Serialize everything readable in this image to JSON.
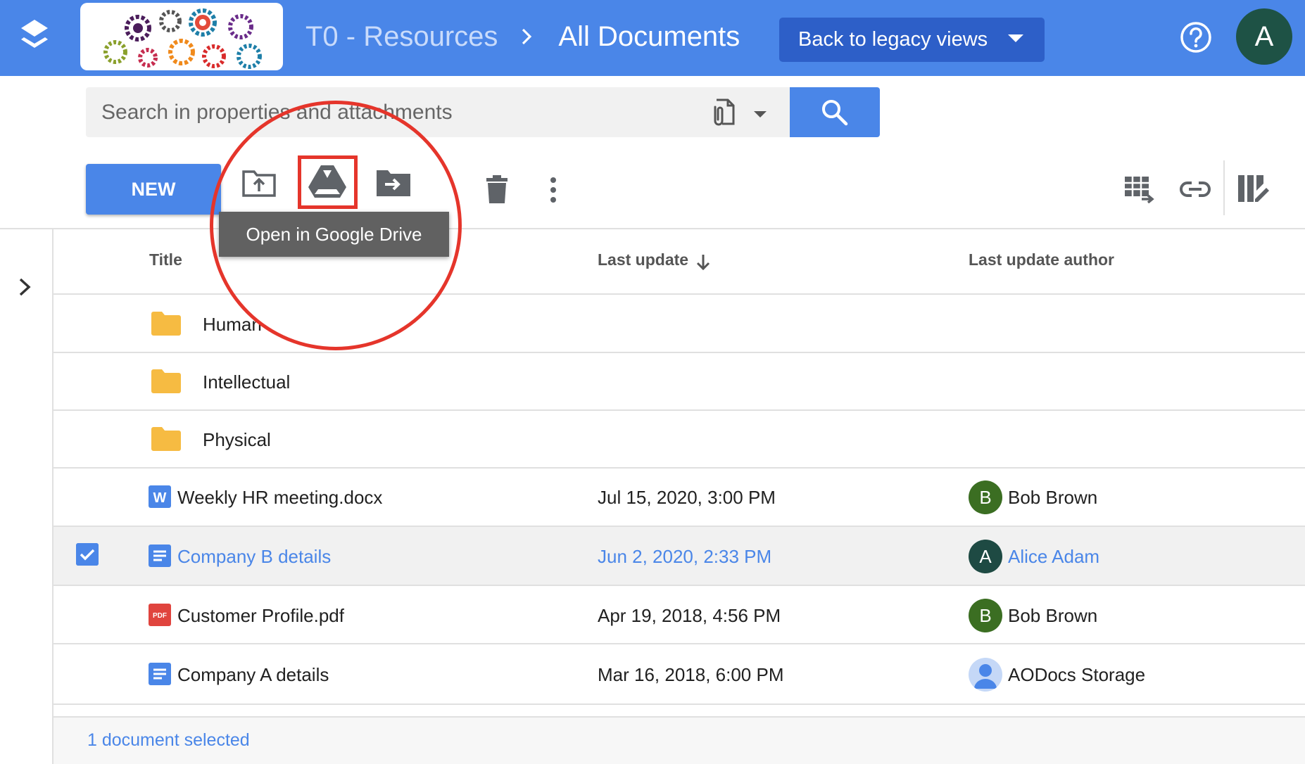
{
  "header": {
    "breadcrumb_parent": "T0 - Resources",
    "breadcrumb_current": "All Documents",
    "legacy_button": "Back to legacy views",
    "avatar_letter": "A",
    "colors": {
      "header": "#4a86e8",
      "legacy_button": "#2d5fc8",
      "avatar": "#1e5245"
    }
  },
  "search": {
    "placeholder": "Search in properties and attachments"
  },
  "toolbar": {
    "new_label": "NEW",
    "tooltip": "Open in Google Drive",
    "icons": [
      "upload-folder-icon",
      "google-drive-icon",
      "move-to-folder-icon",
      "delete-icon",
      "more-vert-icon",
      "export-sheet-icon",
      "link-icon",
      "columns-edit-icon"
    ]
  },
  "table": {
    "columns": [
      "Title",
      "Last update",
      "Last update author"
    ],
    "rows": [
      {
        "title": "Human",
        "type": "folder",
        "date": "",
        "author": ""
      },
      {
        "title": "Intellectual",
        "type": "folder",
        "date": "",
        "author": ""
      },
      {
        "title": "Physical",
        "type": "folder",
        "date": "",
        "author": ""
      },
      {
        "title": "Weekly HR meeting.docx",
        "type": "word",
        "date": "Jul 15, 2020, 3:00 PM",
        "author": "Bob Brown",
        "author_initial": "B"
      },
      {
        "title": "Company B details",
        "type": "gdoc",
        "date": "Jun 2, 2020, 2:33 PM",
        "author": "Alice Adam",
        "author_initial": "A",
        "selected": true
      },
      {
        "title": "Customer Profile.pdf",
        "type": "pdf",
        "date": "Apr 19, 2018, 4:56 PM",
        "author": "Bob Brown",
        "author_initial": "B"
      },
      {
        "title": "Company A details",
        "type": "gdoc",
        "date": "Mar 16, 2018, 6:00 PM",
        "author": "AODocs Storage",
        "author_initial": ""
      }
    ]
  },
  "footer": {
    "selection": "1 document selected"
  }
}
